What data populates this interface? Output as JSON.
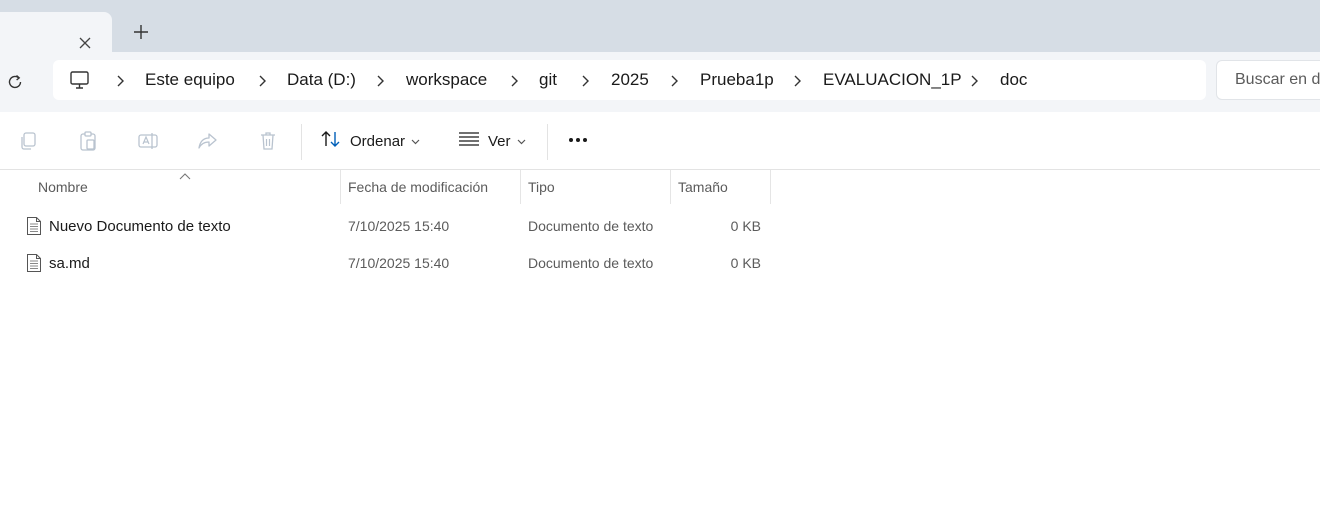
{
  "tabs": {
    "close_icon": "close-icon",
    "new_tab_icon": "plus-icon"
  },
  "address": {
    "refresh_icon": "refresh-icon",
    "root_icon": "computer-icon",
    "crumbs": [
      "Este equipo",
      "Data (D:)",
      "workspace",
      "git",
      "2025",
      "Prueba1p",
      "EVALUACION_1P",
      "doc"
    ],
    "search_placeholder": "Buscar en doc"
  },
  "toolbar": {
    "disabled_icons": [
      "copy-icon",
      "paste-icon",
      "rename-icon",
      "share-icon",
      "delete-icon"
    ],
    "sort_label": "Ordenar",
    "view_label": "Ver",
    "more_icon": "more-icon"
  },
  "columns": {
    "name": "Nombre",
    "modified": "Fecha de modificación",
    "type": "Tipo",
    "size": "Tamaño"
  },
  "files": [
    {
      "name": "Nuevo Documento de texto",
      "modified": "7/10/2025 15:40",
      "type": "Documento de texto",
      "size": "0 KB",
      "icon": "text-file-icon"
    },
    {
      "name": "sa.md",
      "modified": "7/10/2025 15:40",
      "type": "Documento de texto",
      "size": "0 KB",
      "icon": "text-file-icon"
    }
  ],
  "colors": {
    "tabstrip_bg": "#d6dde5",
    "chrome_bg": "#f3f5f8",
    "disabled_icon": "#b9c3cf",
    "accent": "#005fb8"
  }
}
